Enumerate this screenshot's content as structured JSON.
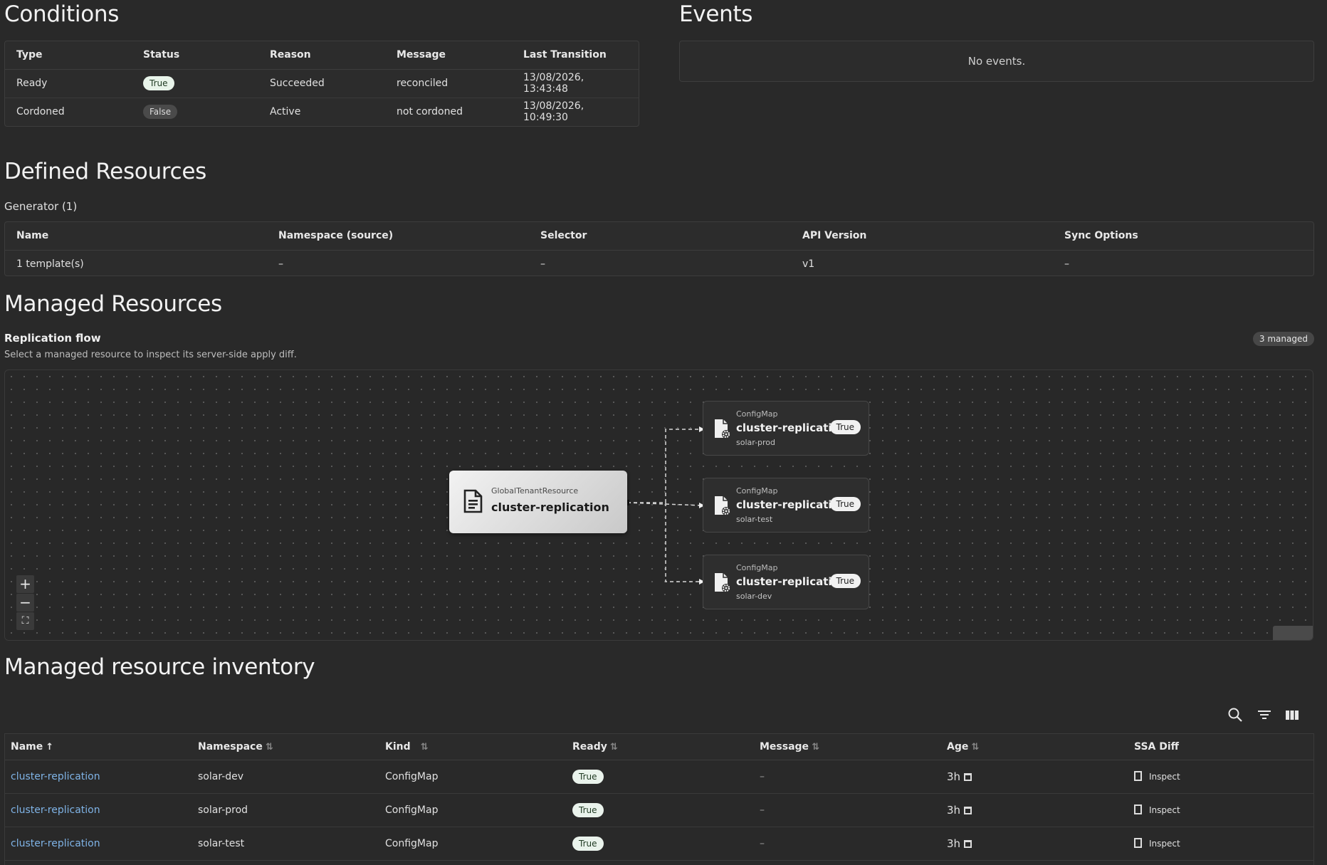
{
  "conditions": {
    "title": "Conditions",
    "columns": [
      "Type",
      "Status",
      "Reason",
      "Message",
      "Last Transition"
    ],
    "rows": [
      {
        "type": "Ready",
        "status": "True",
        "reason": "Succeeded",
        "message": "reconciled",
        "last_transition": "13/08/2026, 13:43:48"
      },
      {
        "type": "Cordoned",
        "status": "False",
        "reason": "Active",
        "message": "not cordoned",
        "last_transition": "13/08/2026, 10:49:30"
      }
    ]
  },
  "events": {
    "title": "Events",
    "empty_text": "No events."
  },
  "defined": {
    "title": "Defined Resources",
    "generator_label": "Generator (1)",
    "columns": [
      "Name",
      "Namespace (source)",
      "Selector",
      "API Version",
      "Sync Options"
    ],
    "row": {
      "name": "1 template(s)",
      "namespace": "–",
      "selector": "–",
      "api_version": "v1",
      "sync_options": "–"
    }
  },
  "managed": {
    "title": "Managed Resources",
    "flow_title": "Replication flow",
    "flow_subtitle": "Select a managed resource to inspect its server-side apply diff.",
    "count_badge": "3 managed",
    "source_node": {
      "kind": "GlobalTenantResource",
      "name": "cluster-replication"
    },
    "target_nodes": [
      {
        "kind": "ConfigMap",
        "name": "cluster-replication",
        "namespace": "solar-prod",
        "status": "True"
      },
      {
        "kind": "ConfigMap",
        "name": "cluster-replication",
        "namespace": "solar-test",
        "status": "True"
      },
      {
        "kind": "ConfigMap",
        "name": "cluster-replication",
        "namespace": "solar-dev",
        "status": "True"
      }
    ],
    "zoom": {
      "in": "+",
      "out": "−",
      "fit": "⛶"
    }
  },
  "inventory": {
    "title": "Managed resource inventory",
    "columns": [
      "Name",
      "Namespace",
      "Kind",
      "Ready",
      "Message",
      "Age",
      "SSA Diff"
    ],
    "rows": [
      {
        "name": "cluster-replication",
        "namespace": "solar-dev",
        "kind": "ConfigMap",
        "ready": "True",
        "message": "–",
        "age": "3h",
        "ssa": "Inspect"
      },
      {
        "name": "cluster-replication",
        "namespace": "solar-prod",
        "kind": "ConfigMap",
        "ready": "True",
        "message": "–",
        "age": "3h",
        "ssa": "Inspect"
      },
      {
        "name": "cluster-replication",
        "namespace": "solar-test",
        "kind": "ConfigMap",
        "ready": "True",
        "message": "–",
        "age": "3h",
        "ssa": "Inspect"
      }
    ],
    "toolbar_icons": [
      "search-icon",
      "filter-icon",
      "columns-icon"
    ]
  },
  "colors": {
    "background": "#292929",
    "link": "#7fb3e6",
    "badge_true": "#e8f4ea"
  }
}
